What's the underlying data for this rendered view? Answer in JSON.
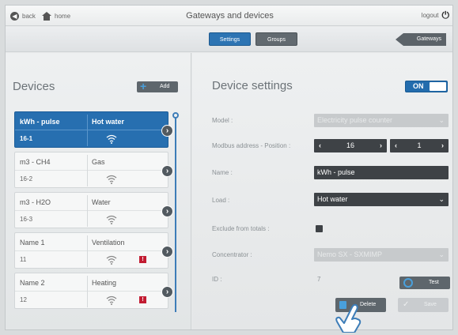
{
  "topbar": {
    "back_label": "back",
    "home_label": "home",
    "title": "Gateways and devices",
    "logout_label": "logout",
    "power_glyph": "⏻"
  },
  "subbar": {
    "tab_settings": "Settings",
    "tab_groups": "Groups",
    "gateways_label": "Gateways"
  },
  "devices": {
    "heading": "Devices",
    "add_label": "Add",
    "items": [
      {
        "name": "kWh - pulse",
        "load": "Hot water",
        "address": "16-1",
        "alarm": ""
      },
      {
        "name": "m3 - CH4",
        "load": "Gas",
        "address": "16-2",
        "alarm": ""
      },
      {
        "name": "m3 - H2O",
        "load": "Water",
        "address": "16-3",
        "alarm": ""
      },
      {
        "name": "Name 1",
        "load": "Ventilation",
        "address": "11",
        "alarm": "!"
      },
      {
        "name": "Name 2",
        "load": "Heating",
        "address": "12",
        "alarm": "!"
      }
    ]
  },
  "settings": {
    "heading": "Device settings",
    "toggle_label": "ON",
    "model_label": "Model :",
    "model_value": "Electricity pulse counter",
    "modbus_label": "Modbus address - Position :",
    "modbus_address": "16",
    "modbus_position": "1",
    "name_label": "Name :",
    "name_value": "kWh - pulse",
    "load_label": "Load :",
    "load_value": "Hot water",
    "exclude_label": "Exclude from totals :",
    "concentrator_label": "Concentrator :",
    "concentrator_value": "Nemo SX - SXMIMP",
    "id_label": "ID :",
    "id_value": "7",
    "test_label": "Test",
    "delete_label": "Delete",
    "save_label": "Save"
  },
  "colors": {
    "accent_blue": "#276fb0",
    "dark_gray": "#3e4246",
    "alarm_red": "#c21c32",
    "icon_blue": "#49a0dc"
  }
}
